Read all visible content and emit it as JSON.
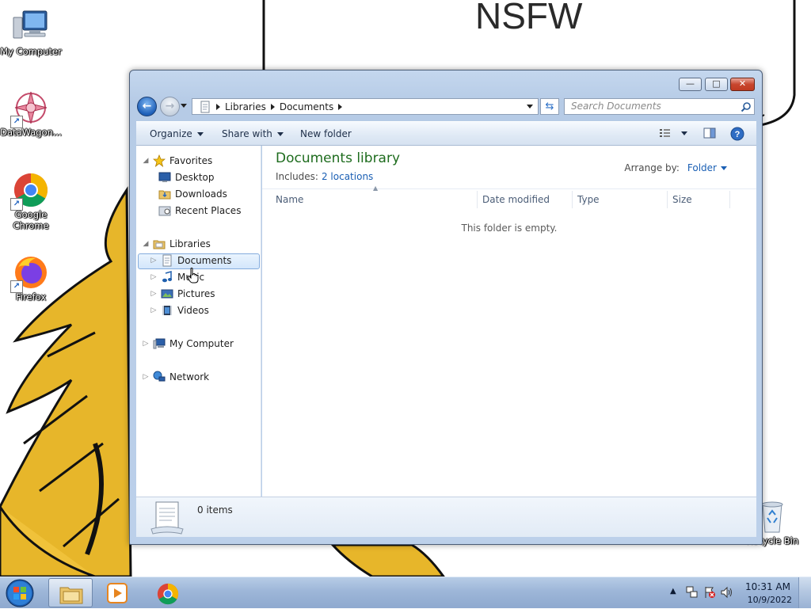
{
  "wallpaper": {
    "sign_text": "NSFW"
  },
  "desktop_icons": [
    {
      "label": "My Computer"
    },
    {
      "label": "DataWagon..."
    },
    {
      "label": "Google Chrome"
    },
    {
      "label": "Firefox"
    },
    {
      "label": "Recycle Bin"
    }
  ],
  "explorer": {
    "caption_buttons": {
      "minimize": "—",
      "maximize": "□",
      "close": "✕"
    },
    "address": {
      "crumbs": [
        "Libraries",
        "Documents"
      ]
    },
    "search": {
      "placeholder": "Search Documents"
    },
    "command_bar": {
      "organize": "Organize",
      "share_with": "Share with",
      "new_folder": "New folder"
    },
    "nav_pane": {
      "favorites": "Favorites",
      "favorites_items": [
        "Desktop",
        "Downloads",
        "Recent Places"
      ],
      "libraries": "Libraries",
      "libraries_items": [
        "Documents",
        "Music",
        "Pictures",
        "Videos"
      ],
      "computer": "My Computer",
      "network": "Network"
    },
    "content": {
      "title": "Documents library",
      "includes_label": "Includes:",
      "includes_link": "2 locations",
      "arrange_label": "Arrange by:",
      "arrange_value": "Folder",
      "columns": [
        "Name",
        "Date modified",
        "Type",
        "Size"
      ],
      "empty_message": "This folder is empty."
    },
    "details": {
      "count": "0 items"
    }
  },
  "taskbar": {
    "clock_time": "10:31 AM",
    "clock_date": "10/9/2022"
  },
  "colors": {
    "library_title": "#1e6c1e",
    "link": "#1a5fb4",
    "selection_border": "#84acdd"
  }
}
